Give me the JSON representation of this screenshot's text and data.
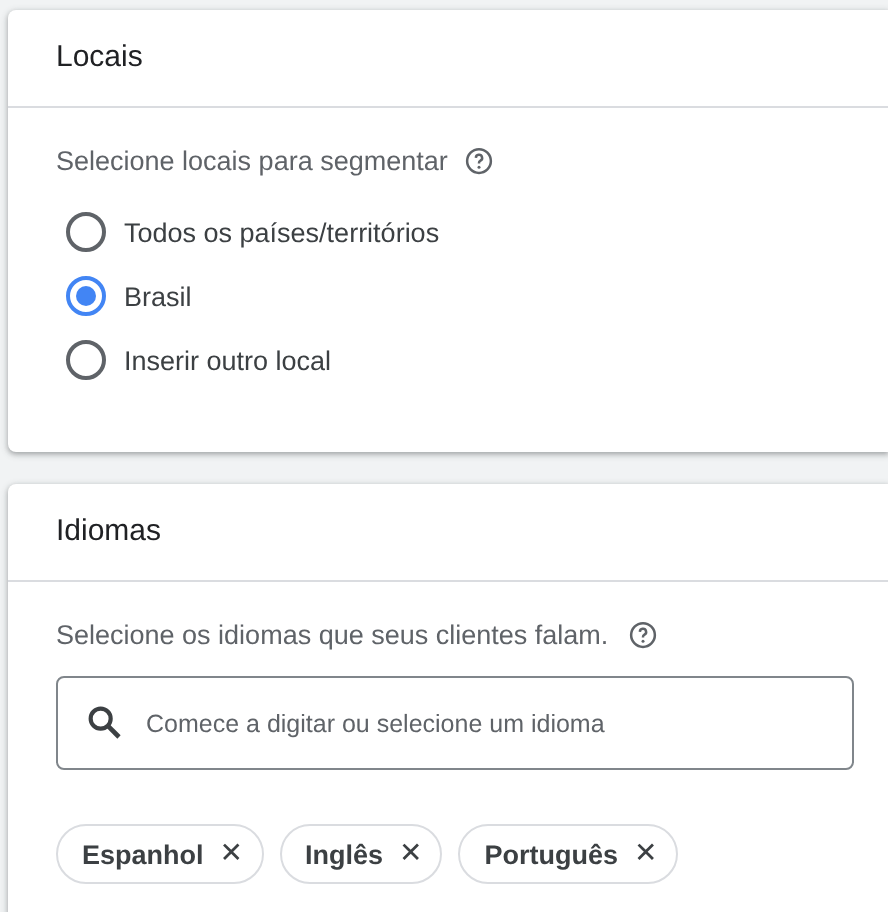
{
  "locations": {
    "title": "Locais",
    "prompt": "Selecione locais para segmentar",
    "options": [
      {
        "label": "Todos os países/territórios",
        "selected": false
      },
      {
        "label": "Brasil",
        "selected": true
      },
      {
        "label": "Inserir outro local",
        "selected": false
      }
    ]
  },
  "languages": {
    "title": "Idiomas",
    "prompt": "Selecione os idiomas que seus clientes falam.",
    "search": {
      "placeholder": "Comece a digitar ou selecione um idioma"
    },
    "chips": [
      {
        "label": "Espanhol",
        "remove": "✕"
      },
      {
        "label": "Inglês",
        "remove": "✕"
      },
      {
        "label": "Português",
        "remove": "✕"
      }
    ]
  }
}
